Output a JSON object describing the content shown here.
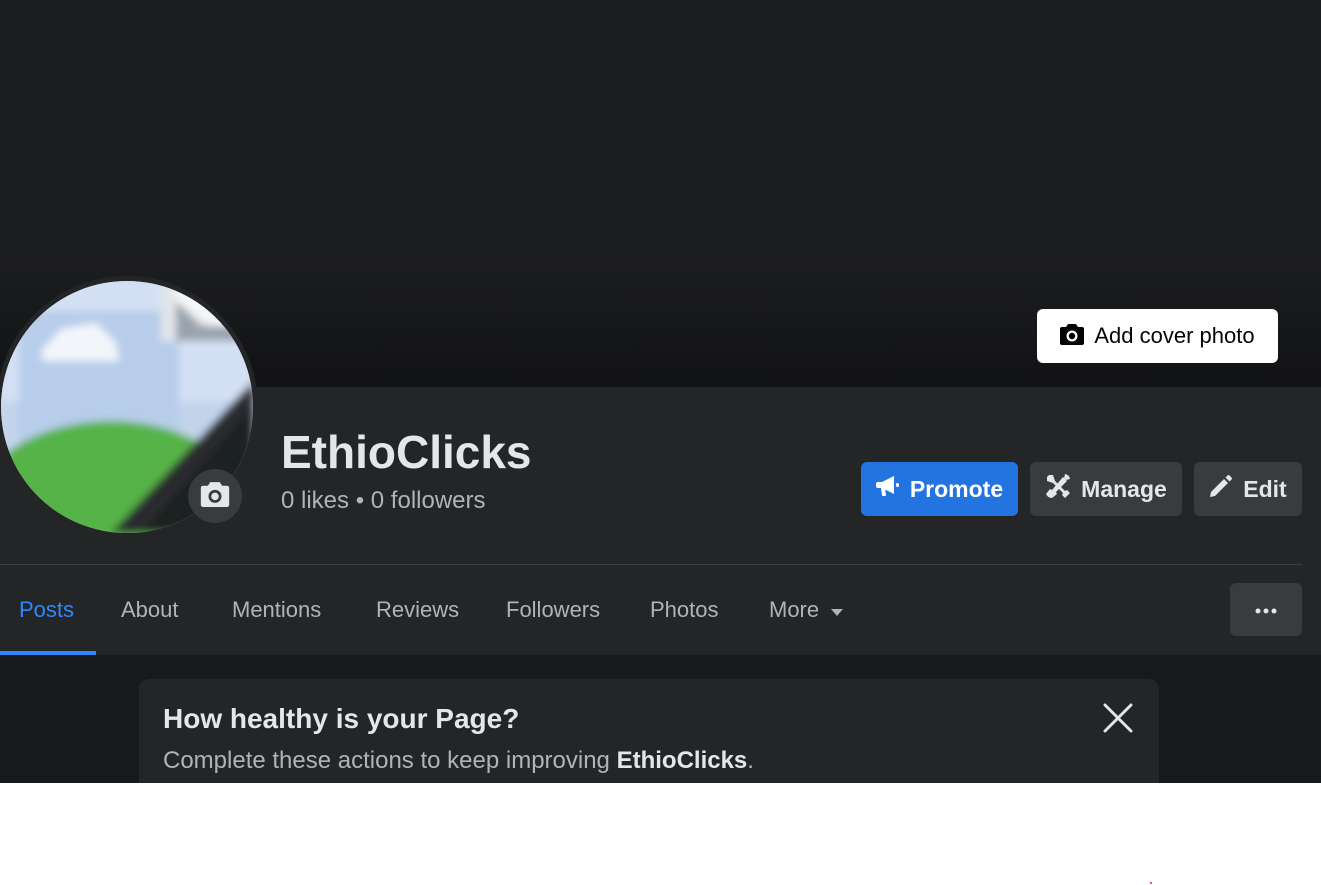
{
  "cover": {
    "add_cover_label": "Add cover photo"
  },
  "profile": {
    "name": "EthioClicks",
    "likes": "0 likes",
    "separator": "•",
    "followers": "0 followers"
  },
  "actions": {
    "promote": "Promote",
    "manage": "Manage",
    "edit": "Edit"
  },
  "tabs": [
    {
      "label": "Posts",
      "active": true
    },
    {
      "label": "About"
    },
    {
      "label": "Mentions"
    },
    {
      "label": "Reviews"
    },
    {
      "label": "Followers"
    },
    {
      "label": "Photos"
    },
    {
      "label": "More"
    }
  ],
  "health_card": {
    "title": "How healthy is your Page?",
    "subtitle_prefix": "Complete these actions to keep improving ",
    "subtitle_name": "EthioClicks",
    "subtitle_suffix": "."
  },
  "colors": {
    "accent": "#2374e1",
    "active_tab": "#2d88ff",
    "background": "#18191a",
    "surface": "#242526"
  },
  "icons": [
    "camera-icon",
    "megaphone-icon",
    "tools-icon",
    "pencil-icon",
    "caret-down-icon",
    "more-dots-icon",
    "close-icon"
  ]
}
